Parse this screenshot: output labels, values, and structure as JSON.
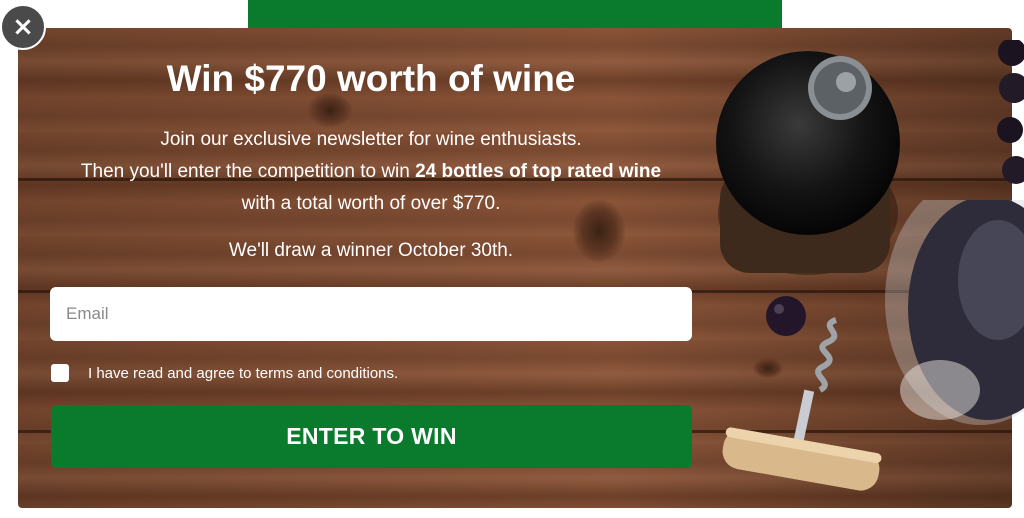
{
  "popup": {
    "close_icon": "×",
    "title": "Win $770 worth of wine",
    "description": {
      "line1": "Join our exclusive newsletter for wine enthusiasts.",
      "line2_prefix": "Then you'll enter the competition to win ",
      "line2_bold": "24 bottles of top rated wine",
      "line3": "with a total worth of over $770."
    },
    "draw_notice": "We'll draw a winner October 30th.",
    "email": {
      "placeholder": "Email",
      "value": ""
    },
    "terms": {
      "label": "I have read and agree to terms and conditions.",
      "checked": false
    },
    "cta_label": "ENTER TO WIN"
  },
  "colors": {
    "accent_green": "#0a7a2c",
    "wood": "#7b4a31",
    "text": "#ffffff",
    "close_button": "#4a4a4a"
  },
  "icons": [
    "close-icon",
    "checkbox-icon"
  ]
}
